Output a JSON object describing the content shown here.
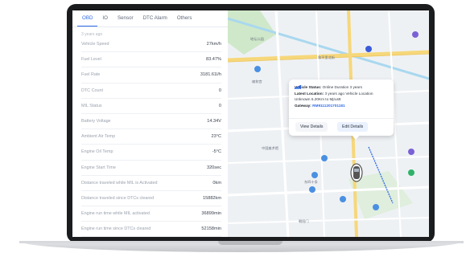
{
  "tabs": [
    "OBD",
    "IO",
    "Sensor",
    "DTC Alarm",
    "Others"
  ],
  "active_tab": "OBD",
  "updated_text": "3 years ago",
  "rows": [
    {
      "label": "Vehicle Speed",
      "value": "27km/h"
    },
    {
      "label": "Fuel Level",
      "value": "83.47%"
    },
    {
      "label": "Fuel Rate",
      "value": "3181.61l/h"
    },
    {
      "label": "DTC Count",
      "value": "0"
    },
    {
      "label": "MIL Status",
      "value": "0"
    },
    {
      "label": "Battery Voltage",
      "value": "14.34V"
    },
    {
      "label": "Ambient Air Temp",
      "value": "23°C"
    },
    {
      "label": "Engine Oil Temp",
      "value": "-5°C"
    },
    {
      "label": "Engine Start Time",
      "value": "320sec"
    },
    {
      "label": "Distance traveled while MIL is Activated",
      "value": "0km"
    },
    {
      "label": "Distance traveled since DTCs cleared",
      "value": "15882km"
    },
    {
      "label": "Engine run time while MIL activated",
      "value": "36899min"
    },
    {
      "label": "Engine run time since DTCs cleared",
      "value": "52158min"
    }
  ],
  "popup": {
    "status_label": "Vehicle Status:",
    "status_value": "Online Duration 3 years",
    "location_label": "Latest Location:",
    "location_value": "3 years ago  Vehicle Location",
    "location_detail": "Unknown  6.20Km to Mjrustt",
    "gateway_label": "Gateway:",
    "gateway_value": "RM9111201701181",
    "view_button": "View Details",
    "edit_button": "Edit Details"
  },
  "colors": {
    "accent": "#2f6be6",
    "road": "#f6d77a",
    "water": "#a9d8ef",
    "park": "#cfe8c9"
  },
  "icons": [
    "signal-bars-icon",
    "car-marker-icon",
    "map-poi-icon",
    "subway-icon"
  ]
}
